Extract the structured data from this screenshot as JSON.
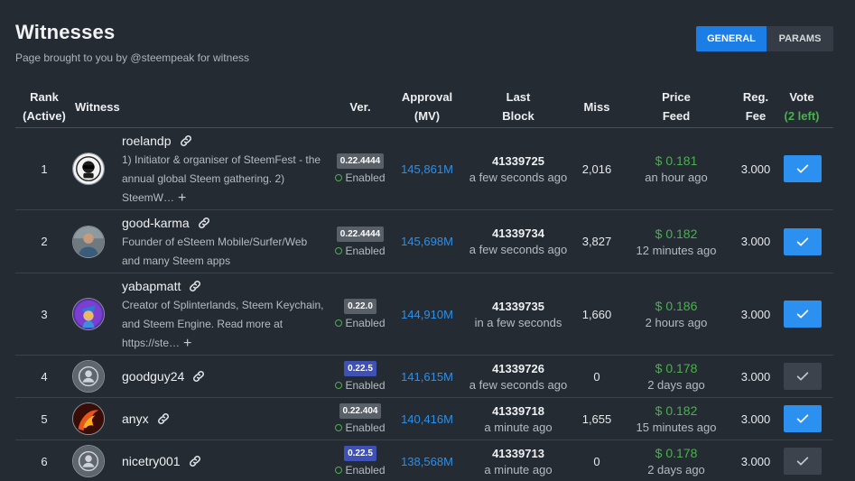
{
  "header": {
    "title": "Witnesses",
    "subtitle": "Page brought to you by @steempeak for witness"
  },
  "tabs": [
    {
      "label": "GENERAL",
      "active": true
    },
    {
      "label": "PARAMS",
      "active": false
    }
  ],
  "columns": {
    "rank": "Rank",
    "rank_sub": "(Active)",
    "witness": "Witness",
    "ver": "Ver.",
    "approval": "Approval",
    "approval_sub": "(MV)",
    "last_block": "Last",
    "last_block_sub": "Block",
    "miss": "Miss",
    "price_feed": "Price",
    "price_feed_sub": "Feed",
    "reg_fee": "Reg.",
    "reg_fee_sub": "Fee",
    "vote": "Vote",
    "vote_sub": "(2 left)"
  },
  "rows": [
    {
      "rank": "1",
      "name": "roelandp",
      "desc": [
        "1) Initiator & organiser of SteemFest - the",
        "annual global Steem gathering. 2)",
        "SteemW…"
      ],
      "has_more": true,
      "version": "0.22.4444",
      "version_color": "gray",
      "status": "Enabled",
      "approval": "145,861M",
      "block": "41339725",
      "block_time": "a few seconds ago",
      "miss": "2,016",
      "price": "$ 0.181",
      "price_time": "an hour ago",
      "fee": "3.000",
      "voted": true,
      "avatar": "sunglasses"
    },
    {
      "rank": "2",
      "name": "good-karma",
      "desc": [
        "Founder of eSteem Mobile/Surfer/Web",
        "and many Steem apps"
      ],
      "has_more": false,
      "version": "0.22.4444",
      "version_color": "gray",
      "status": "Enabled",
      "approval": "145,698M",
      "block": "41339734",
      "block_time": "a few seconds ago",
      "miss": "3,827",
      "price": "$ 0.182",
      "price_time": "12 minutes ago",
      "fee": "3.000",
      "voted": true,
      "avatar": "person"
    },
    {
      "rank": "3",
      "name": "yabapmatt",
      "desc": [
        "Creator of Splinterlands, Steem Keychain,",
        "and Steem Engine. Read more at",
        "https://ste…"
      ],
      "has_more": true,
      "version": "0.22.0",
      "version_color": "gray",
      "status": "Enabled",
      "approval": "144,910M",
      "block": "41339735",
      "block_time": "in a few seconds",
      "miss": "1,660",
      "price": "$ 0.186",
      "price_time": "2 hours ago",
      "fee": "3.000",
      "voted": true,
      "avatar": "cartoon"
    },
    {
      "rank": "4",
      "name": "goodguy24",
      "desc": [],
      "has_more": false,
      "version": "0.22.5",
      "version_color": "blue",
      "status": "Enabled",
      "approval": "141,615M",
      "block": "41339726",
      "block_time": "a few seconds ago",
      "miss": "0",
      "price": "$ 0.178",
      "price_time": "2 days ago",
      "fee": "3.000",
      "voted": false,
      "avatar": "default"
    },
    {
      "rank": "5",
      "name": "anyx",
      "desc": [],
      "has_more": false,
      "version": "0.22.404",
      "version_color": "gray",
      "status": "Enabled",
      "approval": "140,416M",
      "block": "41339718",
      "block_time": "a minute ago",
      "miss": "1,655",
      "price": "$ 0.182",
      "price_time": "15 minutes ago",
      "fee": "3.000",
      "voted": true,
      "avatar": "fire"
    },
    {
      "rank": "6",
      "name": "nicetry001",
      "desc": [],
      "has_more": false,
      "version": "0.22.5",
      "version_color": "blue",
      "status": "Enabled",
      "approval": "138,568M",
      "block": "41339713",
      "block_time": "a minute ago",
      "miss": "0",
      "price": "$ 0.178",
      "price_time": "2 days ago",
      "fee": "3.000",
      "voted": false,
      "avatar": "default"
    }
  ],
  "icons": {
    "link": "link-icon",
    "vote": "check-icon",
    "more": "plus-icon",
    "status": "status-dot-icon"
  },
  "colors": {
    "accent": "#1a7ee6",
    "approval": "#2e8fe8",
    "price": "#4caf50",
    "background": "#252b33"
  }
}
